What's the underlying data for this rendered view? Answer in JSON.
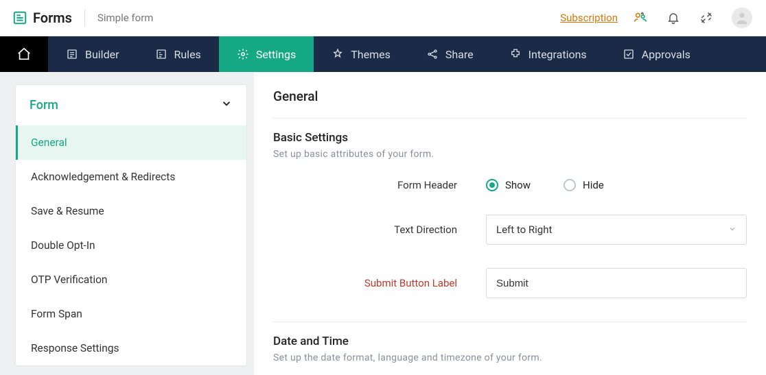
{
  "header": {
    "app_name": "Forms",
    "form_title": "Simple form",
    "subscription_label": "Subscription"
  },
  "nav": {
    "items": [
      {
        "id": "builder",
        "label": "Builder"
      },
      {
        "id": "rules",
        "label": "Rules"
      },
      {
        "id": "settings",
        "label": "Settings",
        "active": true
      },
      {
        "id": "themes",
        "label": "Themes"
      },
      {
        "id": "share",
        "label": "Share"
      },
      {
        "id": "integrations",
        "label": "Integrations"
      },
      {
        "id": "approvals",
        "label": "Approvals"
      }
    ]
  },
  "sidebar": {
    "group_label": "Form",
    "items": [
      {
        "label": "General",
        "active": true
      },
      {
        "label": "Acknowledgement & Redirects"
      },
      {
        "label": "Save & Resume"
      },
      {
        "label": "Double Opt-In"
      },
      {
        "label": "OTP Verification"
      },
      {
        "label": "Form Span"
      },
      {
        "label": "Response Settings"
      }
    ]
  },
  "main": {
    "title": "General",
    "basic": {
      "title": "Basic Settings",
      "subtitle": "Set up basic attributes of your form.",
      "form_header_label": "Form Header",
      "form_header_options": {
        "show": "Show",
        "hide": "Hide"
      },
      "form_header_value": "show",
      "text_direction_label": "Text Direction",
      "text_direction_value": "Left to Right",
      "submit_label_label": "Submit Button Label",
      "submit_label_value": "Submit"
    },
    "datetime": {
      "title": "Date and Time",
      "subtitle": "Set up the date format, language and timezone of your form."
    }
  }
}
